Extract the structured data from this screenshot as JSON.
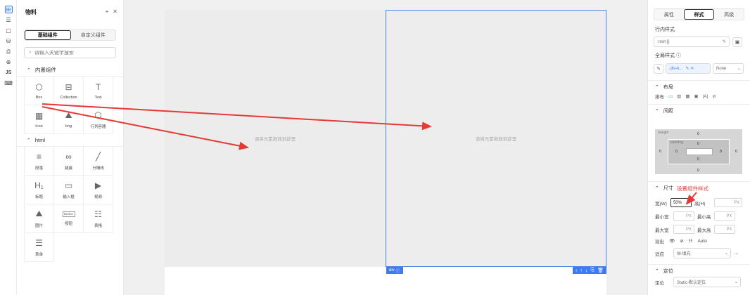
{
  "rail": {
    "items": [
      {
        "name": "add-icon",
        "glyph": "⊞"
      },
      {
        "name": "outline-icon",
        "glyph": "☰"
      },
      {
        "name": "page-icon",
        "glyph": "▢"
      },
      {
        "name": "database-icon",
        "glyph": "⛁"
      },
      {
        "name": "print-icon",
        "glyph": "⎙"
      },
      {
        "name": "globe-icon",
        "glyph": "⊕"
      },
      {
        "name": "js-icon",
        "glyph": "JS"
      },
      {
        "name": "keyboard-icon",
        "glyph": "⌨"
      }
    ]
  },
  "materials": {
    "title": "物料",
    "tabs": [
      "基础组件",
      "自定义组件"
    ],
    "search_placeholder": "请输入关键字搜索",
    "sections": [
      {
        "title": "内置组件",
        "items": [
          {
            "label": "Box",
            "icon": "cube-icon",
            "glyph": "⬡"
          },
          {
            "label": "Collection",
            "icon": "collection-icon",
            "glyph": "⊟"
          },
          {
            "label": "Text",
            "icon": "text-icon",
            "glyph": "T"
          },
          {
            "label": "Icon",
            "icon": "icon-grid-icon",
            "glyph": "▦"
          },
          {
            "label": "Img",
            "icon": "image-icon",
            "glyph": "⛰"
          },
          {
            "label": "行列容器",
            "icon": "container-icon",
            "glyph": "⬡"
          }
        ]
      },
      {
        "title": "html",
        "items": [
          {
            "label": "段落",
            "icon": "paragraph-icon",
            "glyph": "≡"
          },
          {
            "label": "链接",
            "icon": "link-icon",
            "glyph": "∞"
          },
          {
            "label": "分隔线",
            "icon": "divider-icon",
            "glyph": "╱"
          },
          {
            "label": "标题",
            "icon": "heading-icon",
            "glyph": "H₁"
          },
          {
            "label": "输入框",
            "icon": "input-icon",
            "glyph": "▭"
          },
          {
            "label": "视频",
            "icon": "video-icon",
            "glyph": "▶"
          },
          {
            "label": "图片",
            "icon": "picture-icon",
            "glyph": "⛰"
          },
          {
            "label": "按钮",
            "icon": "button-icon",
            "glyph": "Button"
          },
          {
            "label": "表格",
            "icon": "table-icon",
            "glyph": "☷"
          },
          {
            "label": "表单",
            "icon": "form-icon",
            "glyph": "☰"
          }
        ]
      }
    ]
  },
  "canvas": {
    "left_placeholder": "请将元素拖放到这里",
    "right_placeholder": "请将元素拖放到这里",
    "selected_tag": "div",
    "tools": [
      "‹",
      "↑",
      "↓",
      "⎘",
      "🗑"
    ]
  },
  "props": {
    "tabs": [
      "属性",
      "样式",
      "高级"
    ],
    "inline_style_label": "行内样式",
    "inline_style_value": ":root {}",
    "global_style_label": "全局样式",
    "global_class": ".div-k...",
    "global_none": "None",
    "layout_title": "布局",
    "arrange_label": "排布",
    "spacing_title": "间距",
    "box_values": {
      "margin": "margin",
      "padding": "padding",
      "zero": "0"
    },
    "size_title": "尺寸",
    "annotation": "设置组件样式",
    "width_label": "宽(W)",
    "width_value": "50%",
    "height_label": "高(H)",
    "unit": "PX",
    "min_width_label": "最小宽",
    "min_height_label": "最小高",
    "max_width_label": "最大宽",
    "max_height_label": "最大高",
    "overflow_label": "溢出",
    "overflow_auto": "Auto",
    "fit_label": "适应",
    "fit_value": "fill-填充",
    "position_title": "定位",
    "position_label": "定位",
    "position_value": "Static-默认定位"
  }
}
